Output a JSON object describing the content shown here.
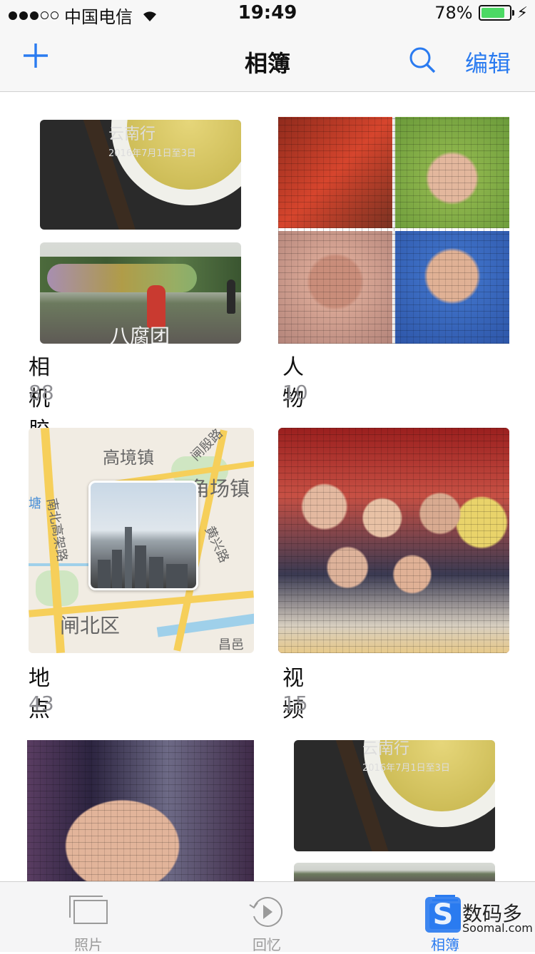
{
  "status_bar": {
    "carrier": "中国电信",
    "time": "19:49",
    "battery": "78%",
    "battery_level": 0.78
  },
  "nav": {
    "title": "相簿",
    "add_icon": "plus-icon",
    "search_icon": "search-icon",
    "edit_label": "编辑"
  },
  "albums": [
    {
      "name": "相机胶卷",
      "count": "88"
    },
    {
      "name": "人物",
      "count": "10"
    },
    {
      "name": "地点",
      "count": "43"
    },
    {
      "name": "视频",
      "count": "15"
    }
  ],
  "thumb_text": {
    "tea_title": "云南行",
    "tea_date": "2016年7月1日至3日",
    "park_caption": "八腐团"
  },
  "map_labels": [
    "高境镇",
    "五角场镇",
    "闸殷路",
    "南北高架路",
    "黄兴路",
    "闸北区",
    "昌邑路",
    "塘"
  ],
  "tabs": [
    {
      "label": "照片",
      "icon": "photos-icon"
    },
    {
      "label": "回忆",
      "icon": "memories-icon"
    },
    {
      "label": "相簿",
      "icon": "albums-icon",
      "active": true
    }
  ],
  "watermark": {
    "brand": "数码多",
    "site": "Soomal.com",
    "logo": "S"
  },
  "colors": {
    "accent": "#2a7bf0",
    "battery": "#4cd964"
  }
}
